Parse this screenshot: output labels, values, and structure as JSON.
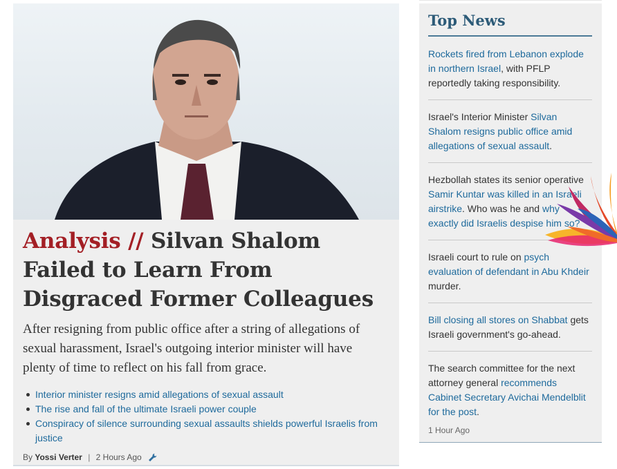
{
  "main_story": {
    "kicker": "Analysis //",
    "headline": "Silvan Shalom Failed to Learn From Disgraced Former Colleagues",
    "dek": "After resigning from public office after a string of allegations of sexual harassment, Israel's outgoing interior minister will have plenty of time to reflect on his fall from grace.",
    "related": [
      "Interior minister resigns amid allegations of sexual assault",
      "The rise and fall of the ultimate Israeli power couple",
      "Conspiracy of silence surrounding sexual assaults shields powerful Israelis from justice"
    ],
    "byline_prefix": "By",
    "author": "Yossi Verter",
    "separator": "|",
    "time": "2 Hours Ago"
  },
  "sidebar": {
    "title": "Top News",
    "items": [
      {
        "link": "Rockets fired from Lebanon explode in northern Israel",
        "text_after": ", with PFLP reportedly taking responsibility."
      },
      {
        "text_before": "Israel's Interior Minister ",
        "link": "Silvan Shalom resigns public office amid allegations of sexual assault",
        "text_after": "."
      },
      {
        "text_before": "Hezbollah states its senior operative ",
        "link": "Samir Kuntar was killed in an Israeli airstrike",
        "text_mid": ". Who was he and ",
        "link2": "why exactly did Israelis despise him so?"
      },
      {
        "text_before": "Israeli court to rule on ",
        "link": "psych evaluation of defendant in Abu Khdeir",
        "text_after": " murder."
      },
      {
        "link": "Bill closing all stores on Shabbat",
        "text_after": " gets Israeli government's go-ahead."
      },
      {
        "text_before": "The search committee for the next attorney general ",
        "link": "recommends Cabinet Secretary Avichai Mendelblit for the post",
        "text_after": "."
      }
    ],
    "timestamp": "1 Hour Ago"
  },
  "icons": {
    "byline_tool": "wrench-icon",
    "decoration": "flower-decoration"
  },
  "colors": {
    "kicker": "#a31f25",
    "link": "#1e6a9c",
    "side_title": "#2d5b78",
    "text": "#333333",
    "panel": "#efefef"
  }
}
